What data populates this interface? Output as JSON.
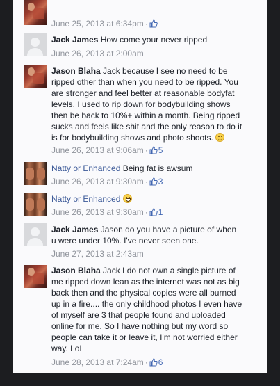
{
  "comments": [
    {
      "meta_time": "June 25, 2013 at 6:34pm",
      "likes": ""
    },
    {
      "author": "Jack James",
      "text": "How come your never ripped",
      "time": "June 26, 2013 at 2:00am"
    },
    {
      "author": "Jason Blaha",
      "text_lines": [
        "Jack because I see no need to be",
        "ripped other than when you need to be ripped. You",
        "are stronger and feel better at reasonable bodyfat",
        "levels. I used to rip down for bodybuilding shows",
        "then be back to 10%+ within a month. Being ripped",
        "sucks and feels like shit and the only reason to do it",
        "is for bodybuilding shows and photo shoots."
      ],
      "time": "June 26, 2013 at 9:06am",
      "likes": "5"
    },
    {
      "author": "Natty or Enhanced",
      "text": "Being fat is awsum",
      "time": "June 26, 2013 at 9:30am",
      "likes": "3"
    },
    {
      "author": "Natty or Enhanced",
      "text": "",
      "time": "June 26, 2013 at 9:30am",
      "likes": "1"
    },
    {
      "author": "Jack James",
      "text_lines": [
        "Jason do you have a picture of when",
        "u were under 10%. I've never seen one."
      ],
      "time": "June 27, 2013 at 2:43am"
    },
    {
      "author": "Jason Blaha",
      "text_lines": [
        "Jack I do not own a single picture of",
        "me ripped down lean as the internet was not as big",
        "back then and the physical copies were all burned",
        "up in a fire.... the only childhood photos I even have",
        "of myself are 3 that people found and uploaded",
        "online for me. So I have nothing but my word so",
        "people can take it or leave it, I'm not worried either",
        "way. LoL"
      ],
      "time": "June 28, 2013 at 7:24am",
      "likes": "6"
    }
  ],
  "sep": "·"
}
